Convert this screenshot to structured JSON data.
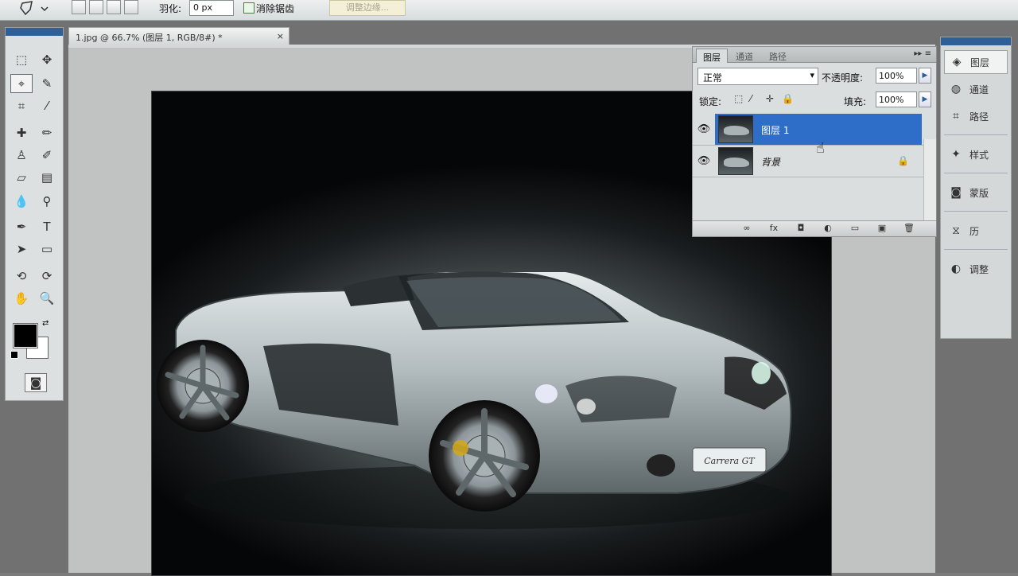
{
  "options_bar": {
    "feather_label": "羽化:",
    "feather_value": "0 px",
    "antialias_label": "消除锯齿",
    "refine_edge_label": "调整边缘..."
  },
  "document": {
    "tab_title": "1.jpg @ 66.7% (图层 1, RGB/8#) *",
    "close_glyph": "×"
  },
  "layers_panel": {
    "tabs": [
      "图层",
      "通道",
      "路径"
    ],
    "active_tab": "图层",
    "blend_mode": "正常",
    "opacity_label": "不透明度:",
    "opacity_value": "100%",
    "lock_label": "锁定:",
    "fill_label": "填充:",
    "fill_value": "100%",
    "layers": [
      {
        "name": "图层 1",
        "visible": true,
        "selected": true,
        "locked": false
      },
      {
        "name": "背景",
        "visible": true,
        "selected": false,
        "locked": true
      }
    ]
  },
  "dock": {
    "items": [
      {
        "label": "图层",
        "icon": "layers-icon",
        "active": true
      },
      {
        "label": "通道",
        "icon": "channels-icon",
        "active": false
      },
      {
        "label": "路径",
        "icon": "paths-icon",
        "active": false
      },
      {
        "label": "样式",
        "icon": "styles-icon",
        "active": false
      },
      {
        "label": "蒙版",
        "icon": "masks-icon",
        "active": false
      },
      {
        "label": "历",
        "icon": "history-icon",
        "active": false
      },
      {
        "label": "调整",
        "icon": "adjustments-icon",
        "active": false
      }
    ]
  },
  "toolbox": {
    "active_tool": "polygonal-lasso-tool",
    "foreground_color": "#000000",
    "background_color": "#ffffff"
  },
  "colors": {
    "selection": "#2f6ec8",
    "accent": "#2e5f97"
  },
  "photo": {
    "license_plate_text": "Carrera GT"
  }
}
